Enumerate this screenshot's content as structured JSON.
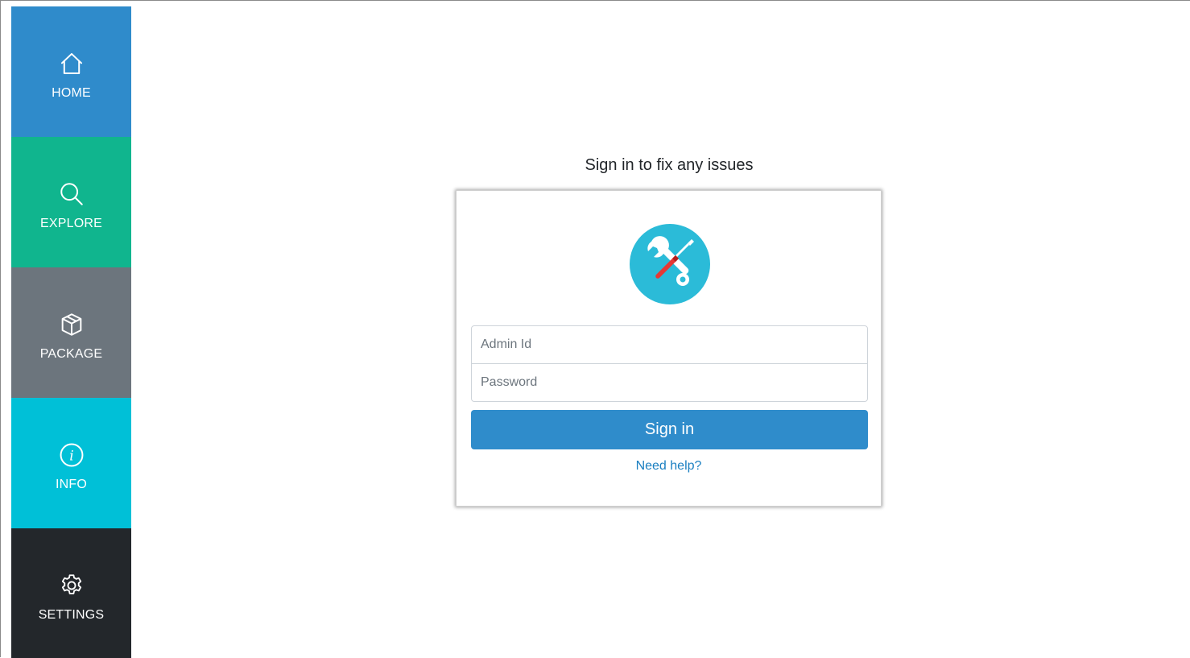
{
  "sidebar": {
    "items": [
      {
        "label": "HOME",
        "icon": "home-icon",
        "color": "#2f8bcb"
      },
      {
        "label": "EXPLORE",
        "icon": "search-icon",
        "color": "#10b58e"
      },
      {
        "label": "PACKAGE",
        "icon": "box-icon",
        "color": "#6c757d"
      },
      {
        "label": "INFO",
        "icon": "info-icon",
        "color": "#00c0d7"
      },
      {
        "label": "SETTINGS",
        "icon": "gear-icon",
        "color": "#23272b"
      }
    ]
  },
  "login": {
    "heading": "Sign in to fix any issues",
    "logo_icon": "tools-icon",
    "admin_id_placeholder": "Admin Id",
    "password_placeholder": "Password",
    "signin_label": "Sign in",
    "help_link": "Need help?",
    "accent_color": "#2f8ccb"
  }
}
